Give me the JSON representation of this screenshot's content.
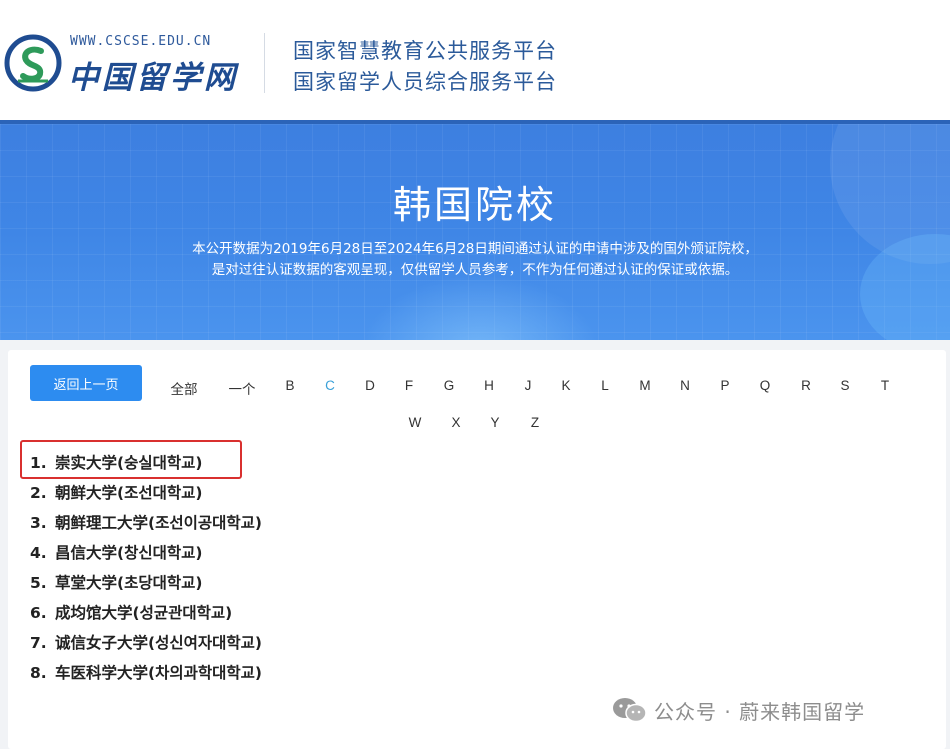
{
  "header": {
    "site_url": "WWW.CSCSE.EDU.CN",
    "site_name": "中国留学网",
    "platform_line1": "国家智慧教育公共服务平台",
    "platform_line2": "国家留学人员综合服务平台"
  },
  "banner": {
    "title": "韩国院校",
    "desc_line1": "本公开数据为2019年6月28日至2024年6月28日期间通过认证的申请中涉及的国外颁证院校，",
    "desc_line2": "是对过往认证数据的客观呈现，仅供留学人员参考，不作为任何通过认证的保证或依据。"
  },
  "filter": {
    "back_label": "返回上一页",
    "active": "C",
    "row1": [
      "全部",
      "一个",
      "B",
      "C",
      "D",
      "F",
      "G",
      "H",
      "J",
      "K",
      "L",
      "M",
      "N",
      "P",
      "Q",
      "R",
      "S",
      "T"
    ],
    "row2": [
      "W",
      "X",
      "Y",
      "Z"
    ]
  },
  "schools": [
    {
      "num": "1.",
      "cn": "崇实大学",
      "ko": "(숭실대학교)"
    },
    {
      "num": "2.",
      "cn": "朝鲜大学",
      "ko": "(조선대학교)"
    },
    {
      "num": "3.",
      "cn": "朝鲜理工大学",
      "ko": "(조선이공대학교)"
    },
    {
      "num": "4.",
      "cn": "昌信大学",
      "ko": "(창신대학교)"
    },
    {
      "num": "5.",
      "cn": "草堂大学",
      "ko": "(초당대학교)"
    },
    {
      "num": "6.",
      "cn": "成均馆大学",
      "ko": "(성균관대학교)"
    },
    {
      "num": "7.",
      "cn": "诚信女子大学",
      "ko": "(성신여자대학교)"
    },
    {
      "num": "8.",
      "cn": "车医科学大学",
      "ko": "(차의과학대학교)"
    }
  ],
  "watermark": {
    "text": "公众号 · 蔚来韩国留学",
    "icon": "wechat-icon"
  },
  "colors": {
    "banner": "#3f86e6",
    "button": "#2d8cf0",
    "active_letter": "#39a0d8",
    "highlight": "#d9302f"
  }
}
